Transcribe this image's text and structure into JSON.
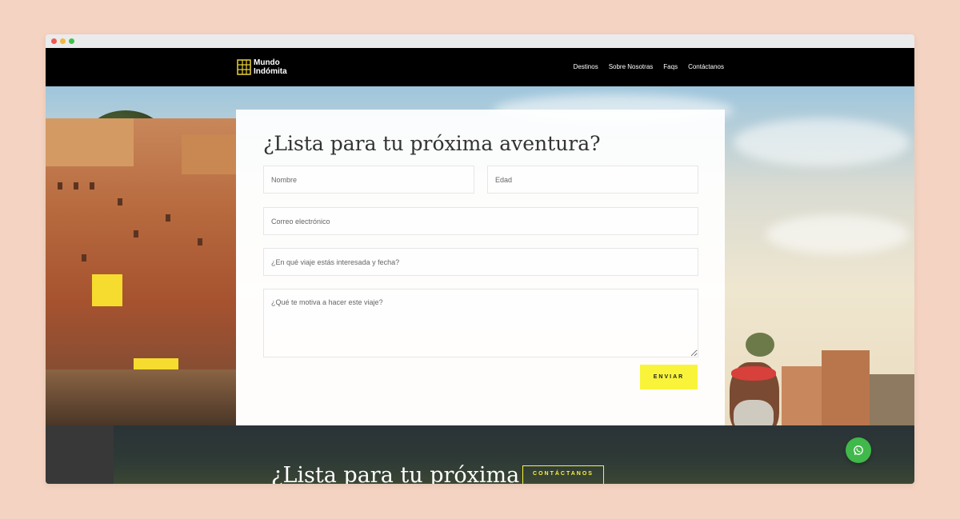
{
  "brand": {
    "name_line1": "Mundo",
    "name_line2": "Indómita"
  },
  "nav": {
    "items": [
      "Destinos",
      "Sobre Nosotras",
      "Faqs",
      "Contáctanos"
    ]
  },
  "form": {
    "title": "¿Lista para tu próxima aventura?",
    "name_placeholder": "Nombre",
    "age_placeholder": "Edad",
    "email_placeholder": "Correo electrónico",
    "trip_placeholder": "¿En qué viaje estás interesada y fecha?",
    "motivation_placeholder": "¿Qué te motiva a hacer este viaje?",
    "submit_label": "ENVIAR"
  },
  "cta": {
    "title": "¿Lista para tu próxima",
    "button_label": "CONTÁCTANOS"
  },
  "colors": {
    "accent": "#f9f43a",
    "navbar": "#000000",
    "whatsapp": "#40b84a",
    "background": "#f4d3c2"
  },
  "icons": {
    "logo": "logo-mark-icon",
    "whatsapp": "whatsapp-icon"
  }
}
